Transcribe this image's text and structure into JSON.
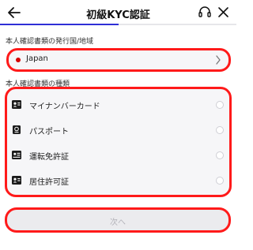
{
  "header": {
    "title": "初級KYC認証",
    "back_icon": "arrow-left-icon",
    "support_icon": "headset-icon",
    "close_icon": "close-icon",
    "accent_color": "#2f2fd6",
    "progress_fraction": 0.5
  },
  "country": {
    "section_label": "本人確認書類の発行国/地域",
    "value": "Japan",
    "flag_color": "#d60000"
  },
  "documents": {
    "section_label": "本人確認書類の種類",
    "items": [
      {
        "label": "マイナンバーカード",
        "icon": "id-card-icon",
        "selected": false
      },
      {
        "label": "パスポート",
        "icon": "passport-icon",
        "selected": false
      },
      {
        "label": "運転免許証",
        "icon": "driver-license-icon",
        "selected": false
      },
      {
        "label": "居住許可証",
        "icon": "residence-permit-icon",
        "selected": false
      }
    ]
  },
  "footer": {
    "next_label": "次へ",
    "next_enabled": false
  },
  "highlight_color": "#ff1a1a"
}
